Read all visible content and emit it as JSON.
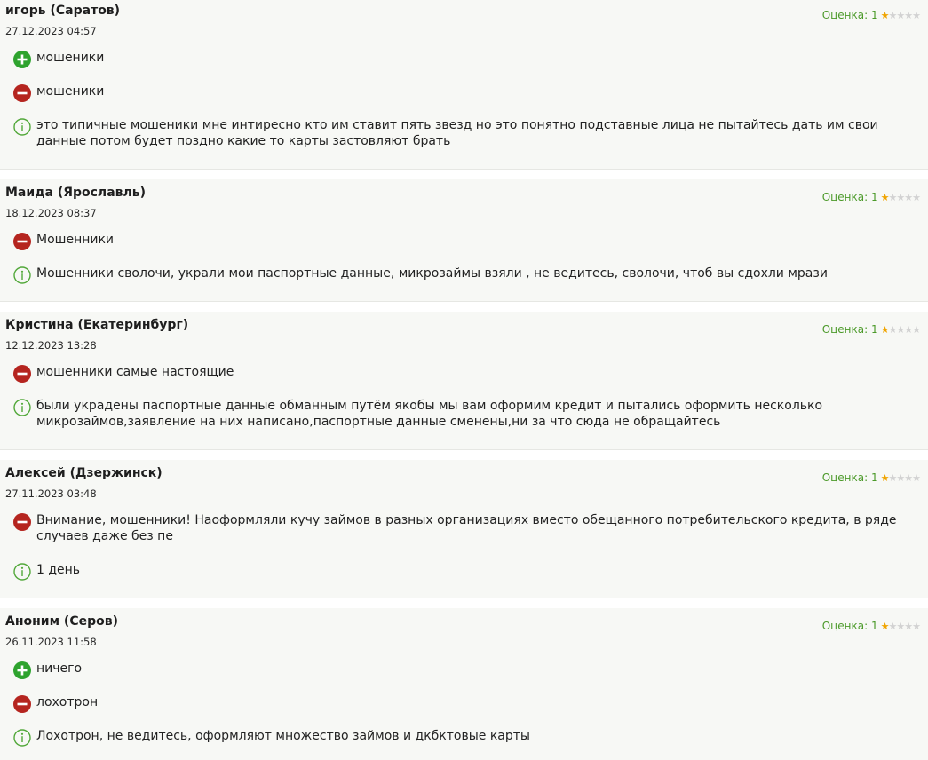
{
  "rating_label": "Оценка: 1",
  "colors": {
    "plus": "#2ea32e",
    "minus": "#b5251f",
    "info": "#52a83a",
    "rating_text": "#4c9a2a",
    "star_on": "#f0a400",
    "star_off": "#d2d2d2"
  },
  "reviews": [
    {
      "author": "игорь (Саратов)",
      "date": "27.12.2023 04:57",
      "rating_value": 1,
      "plus": "мошеники",
      "minus": "мошеники",
      "comment": "это типичные мошеники мне интиресно кто им ставит пять звезд но это понятно подставные лица не пытайтесь дать им свои данные потом будет поздно какие то карты застовляют брать"
    },
    {
      "author": "Маида (Ярославль)",
      "date": "18.12.2023 08:37",
      "rating_value": 1,
      "minus": "Мошенники",
      "comment": "Мошенники сволочи, украли мои паспортные данные, микрозаймы взяли , не ведитесь, сволочи, чтоб вы сдохли мрази"
    },
    {
      "author": "Кристина (Екатеринбург)",
      "date": "12.12.2023 13:28",
      "rating_value": 1,
      "minus": "мошенники самые настоящие",
      "comment": "были украдены паспортные данные обманным путём якобы мы вам оформим кредит и пытались оформить несколько микрозаймов,заявление на них написано,паспортные данные сменены,ни за что сюда не обращайтесь"
    },
    {
      "author": "Алексей (Дзержинск)",
      "date": "27.11.2023 03:48",
      "rating_value": 1,
      "minus": "Внимание, мошенники! Наоформляли кучу займов в разных организациях вместо обещанного потребительского кредита, в ряде случаев даже без пе",
      "comment": "1 день"
    },
    {
      "author": "Аноним (Серов)",
      "date": "26.11.2023 11:58",
      "rating_value": 1,
      "plus": "ничего",
      "minus": "лохотрон",
      "comment": "Лохотрон, не ведитесь, оформляют множество займов и дкбктовые карты"
    }
  ]
}
